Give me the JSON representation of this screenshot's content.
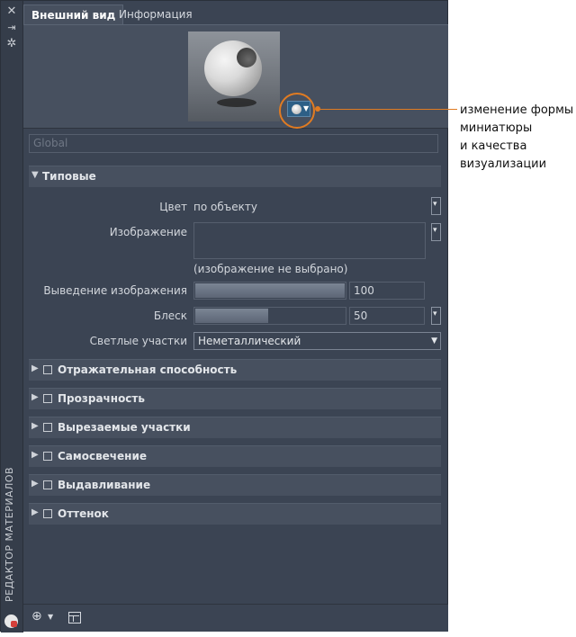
{
  "window": {
    "vertical_title": "РЕДАКТОР МАТЕРИАЛОВ"
  },
  "tabs": [
    {
      "label": "Внешний вид",
      "active": true
    },
    {
      "label": "Информация",
      "active": false
    }
  ],
  "preview": {
    "shape_button_icon": "sphere-preview-icon",
    "callout_lines": [
      "изменение формы",
      "миниатюры",
      "и качества",
      "визуализации"
    ]
  },
  "material_name_placeholder": "Global",
  "sections": {
    "generic": {
      "label": "Типовые",
      "expanded": true
    },
    "collapsed": [
      {
        "label": "Отражательная способность",
        "checked": false
      },
      {
        "label": "Прозрачность",
        "checked": false
      },
      {
        "label": "Вырезаемые участки",
        "checked": false
      },
      {
        "label": "Самосвечение",
        "checked": false
      },
      {
        "label": "Выдавливание",
        "checked": false
      },
      {
        "label": "Оттенок",
        "checked": false
      }
    ]
  },
  "properties": {
    "color_label": "Цвет",
    "color_value": "по объекту",
    "image_label": "Изображение",
    "image_none": "(изображение не выбрано)",
    "fade_label": "Выведение изображения",
    "fade_value": "100",
    "fade_percent": 100,
    "gloss_label": "Блеск",
    "gloss_value": "50",
    "gloss_percent": 50,
    "highlights_label": "Светлые участки",
    "highlights_value": "Неметаллический"
  },
  "colors": {
    "panel": "#3b4453",
    "header": "#47505f",
    "accent_orange": "#e07b22",
    "button_blue": "#2d5f86"
  }
}
